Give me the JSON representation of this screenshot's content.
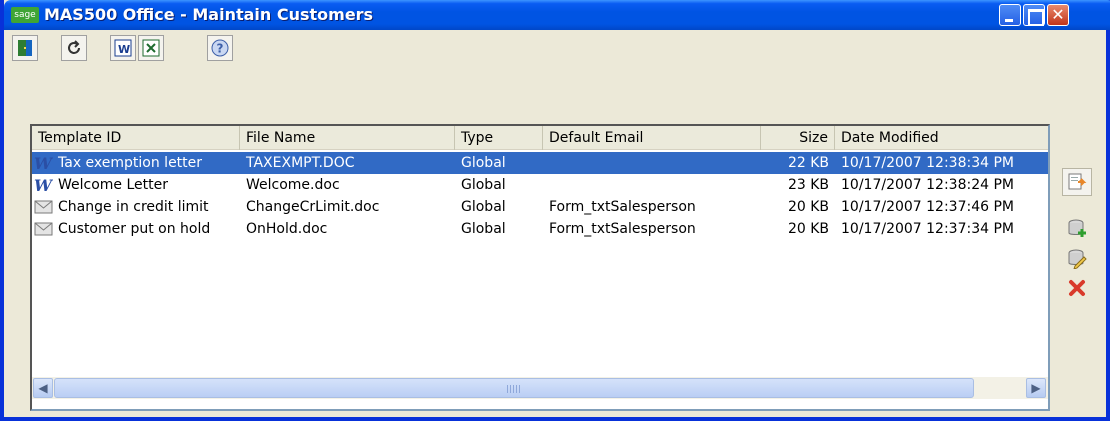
{
  "window": {
    "logo_text": "sage",
    "title": "MAS500 Office - Maintain Customers",
    "controls": {
      "minimize": "minimize",
      "maximize": "maximize",
      "close": "close"
    }
  },
  "toolbar": {
    "items": [
      {
        "icon": "exit-door-icon"
      },
      {
        "icon": "refresh-icon"
      },
      {
        "icon": "word-document-icon"
      },
      {
        "icon": "excel-document-icon"
      },
      {
        "icon": "help-icon"
      }
    ]
  },
  "list": {
    "columns": [
      "Template ID",
      "File Name",
      "Type",
      "Default Email",
      "Size",
      "Date Modified"
    ],
    "rows": [
      {
        "icon": "word-icon",
        "template_id": "Tax exemption letter",
        "file_name": "TAXEXMPT.DOC",
        "type": "Global",
        "default_email": "",
        "size": "22 KB",
        "date_modified": "10/17/2007 12:38:34 PM",
        "selected": true
      },
      {
        "icon": "word-icon",
        "template_id": "Welcome Letter",
        "file_name": "Welcome.doc",
        "type": "Global",
        "default_email": "",
        "size": "23 KB",
        "date_modified": "10/17/2007 12:38:24 PM",
        "selected": false
      },
      {
        "icon": "envelope-icon",
        "template_id": "Change in credit limit",
        "file_name": "ChangeCrLimit.doc",
        "type": "Global",
        "default_email": "Form_txtSalesperson",
        "size": "20 KB",
        "date_modified": "10/17/2007 12:37:46 PM",
        "selected": false
      },
      {
        "icon": "envelope-icon",
        "template_id": "Customer put on hold",
        "file_name": "OnHold.doc",
        "type": "Global",
        "default_email": "Form_txtSalesperson",
        "size": "20 KB",
        "date_modified": "10/17/2007 12:37:34 PM",
        "selected": false
      }
    ]
  },
  "side_buttons": [
    {
      "icon": "merge-document-icon"
    },
    {
      "icon": "add-template-icon"
    },
    {
      "icon": "edit-template-icon"
    },
    {
      "icon": "delete-icon"
    }
  ],
  "colors": {
    "titlebar": "#0054E3",
    "selection": "#316AC5",
    "window_bg": "#ECE9D8"
  }
}
